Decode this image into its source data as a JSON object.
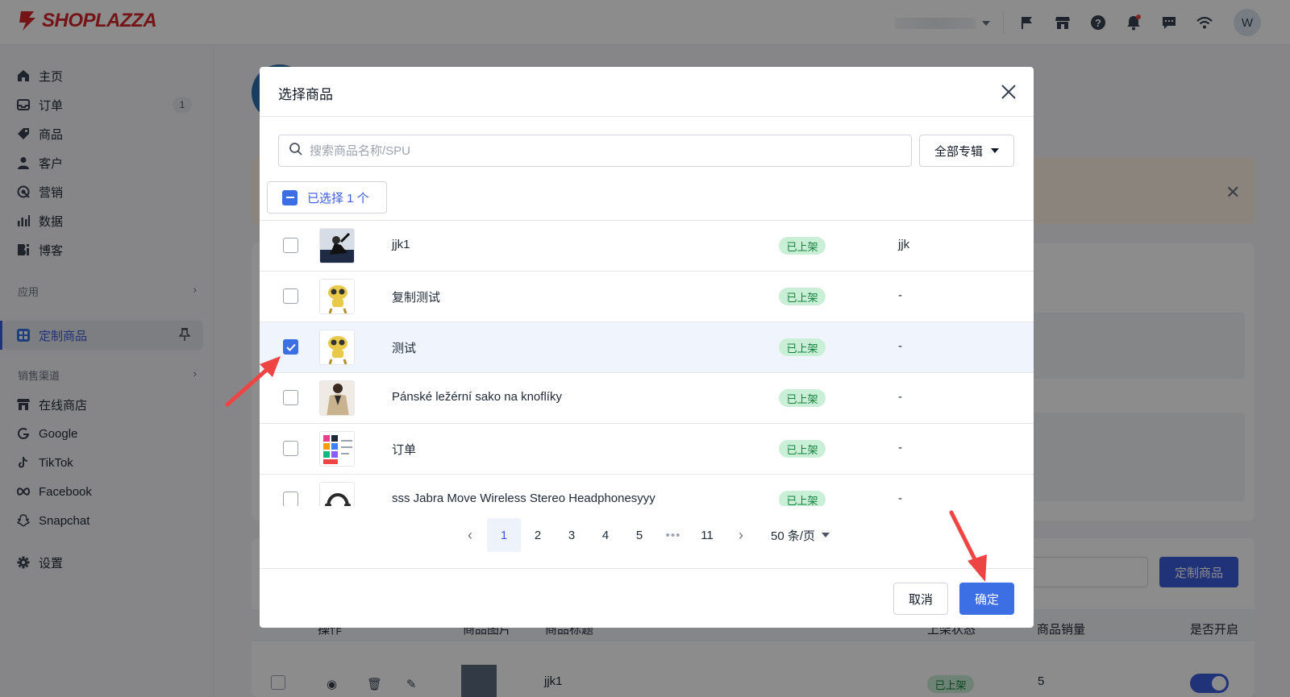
{
  "app": {
    "brand": "SHOPLAZZA",
    "user_initial": "W"
  },
  "colors": {
    "brand": "#d6262b",
    "accent": "#3b6fe3",
    "status_green_bg": "#c9efd7",
    "status_green_text": "#15803d",
    "annotation_arrow": "#ef4444"
  },
  "topbar": {
    "icons": [
      "flag-icon",
      "store-icon",
      "help-icon",
      "bell-icon",
      "chat-icon",
      "wifi-icon"
    ]
  },
  "sidebar": {
    "items": [
      {
        "label": "主页",
        "icon": "home-icon"
      },
      {
        "label": "订单",
        "icon": "inbox-icon",
        "badge": "1"
      },
      {
        "label": "商品",
        "icon": "tag-icon"
      },
      {
        "label": "客户",
        "icon": "user-icon"
      },
      {
        "label": "营销",
        "icon": "target-icon"
      },
      {
        "label": "数据",
        "icon": "bar-chart-icon"
      },
      {
        "label": "博客",
        "icon": "blog-icon"
      }
    ],
    "apps_section": "应用",
    "active_app": "定制商品",
    "channels_section": "销售渠道",
    "channels": [
      {
        "label": "在线商店",
        "icon": "store-icon"
      },
      {
        "label": "Google",
        "icon": "google-icon"
      },
      {
        "label": "TikTok",
        "icon": "tiktok-icon"
      },
      {
        "label": "Facebook",
        "icon": "meta-icon"
      },
      {
        "label": "Snapchat",
        "icon": "snapchat-icon"
      }
    ],
    "settings": "设置"
  },
  "background_page": {
    "custom_product_button": "定制商品",
    "table_headers": [
      "操作",
      "商品图片",
      "商品标题",
      "上架状态",
      "商品销量",
      "是否开启"
    ],
    "first_row": {
      "title": "jjk1",
      "status": "已上架",
      "sales": "5"
    }
  },
  "modal": {
    "title": "选择商品",
    "search_placeholder": "搜索商品名称/SPU",
    "search_value": "",
    "collection_select": "全部专辑",
    "selected_summary": "已选择 1 个",
    "products": [
      {
        "title": "jjk1",
        "status": "已上架",
        "extra": "jjk",
        "checked": false,
        "thumb": "photo"
      },
      {
        "title": "复制测试",
        "status": "已上架",
        "extra": "-",
        "checked": false,
        "thumb": "robot"
      },
      {
        "title": "测试",
        "status": "已上架",
        "extra": "-",
        "checked": true,
        "thumb": "robot"
      },
      {
        "title": "Pánské ležérní sako na knoflíky",
        "status": "已上架",
        "extra": "-",
        "checked": false,
        "thumb": "jacket"
      },
      {
        "title": "订单",
        "status": "已上架",
        "extra": "-",
        "checked": false,
        "thumb": "grid"
      },
      {
        "title": "sss Jabra Move Wireless Stereo Headphonesyyy",
        "status": "已上架",
        "extra": "-",
        "checked": false,
        "thumb": "headphones"
      }
    ],
    "pagination": {
      "prev": "‹",
      "pages": [
        "1",
        "2",
        "3",
        "4",
        "5",
        "•••",
        "11"
      ],
      "current": "1",
      "next": "›",
      "per_page": "50 条/页"
    },
    "cancel_label": "取消",
    "confirm_label": "确定"
  }
}
